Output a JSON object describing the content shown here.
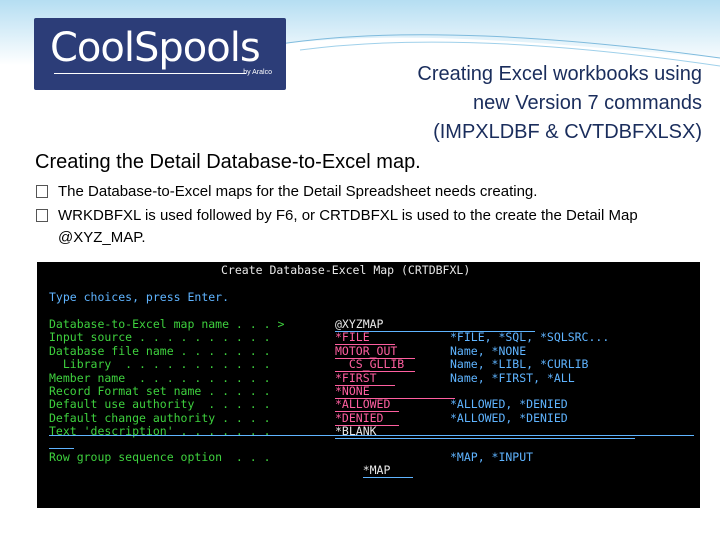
{
  "logo": {
    "brand": "CoolSpools",
    "sub": "by Aralco"
  },
  "slide": {
    "title_lines": [
      "Creating Excel workbooks using",
      "new Version 7 commands",
      "(IMPXLDBF & CVTDBFXLSX)"
    ],
    "subtitle": "Creating the Detail Database-to-Excel map.",
    "bullets": [
      "The Database-to-Excel maps for the Detail Spreadsheet needs creating.",
      "WRKDBFXL is used followed by F6, or CRTDBFXL is used to the create the Detail Map @XYZ_MAP."
    ]
  },
  "terminal": {
    "header": "Create Database-Excel Map (CRTDBFXL)",
    "prompt": "Type choices, press Enter.",
    "rows": [
      {
        "label": "Database-to-Excel map name . . . >",
        "value": "@XYZMAP",
        "hint": ""
      },
      {
        "label": "Input source . . . . . . . . . .",
        "value": "*FILE",
        "hint": "*FILE, *SQL, *SQLSRC..."
      },
      {
        "label": "Database file name . . . . . . .",
        "value": "MOTOR_OUT",
        "hint": "Name, *NONE"
      },
      {
        "label": "  Library  . . . . . . . . . . .",
        "value": "  CS_GLLIB",
        "hint": "Name, *LIBL, *CURLIB"
      },
      {
        "label": "Member name  . . . . . . . . . .",
        "value": "*FIRST",
        "hint": "Name, *FIRST, *ALL"
      },
      {
        "label": "Record Format set name . . . . .",
        "value": "*NONE",
        "hint": ""
      },
      {
        "label": "Default use authority  . . . . .",
        "value": "*ALLOWED",
        "hint": "*ALLOWED, *DENIED"
      },
      {
        "label": "Default change authority . . . .",
        "value": "*DENIED",
        "hint": "*ALLOWED, *DENIED"
      },
      {
        "label": "Text 'description' . . . . . . .",
        "value": "*BLANK",
        "hint": ""
      }
    ],
    "group_row": {
      "label": "Row group sequence option  . . .",
      "value": "*MAP",
      "hint": "*MAP, *INPUT"
    }
  }
}
